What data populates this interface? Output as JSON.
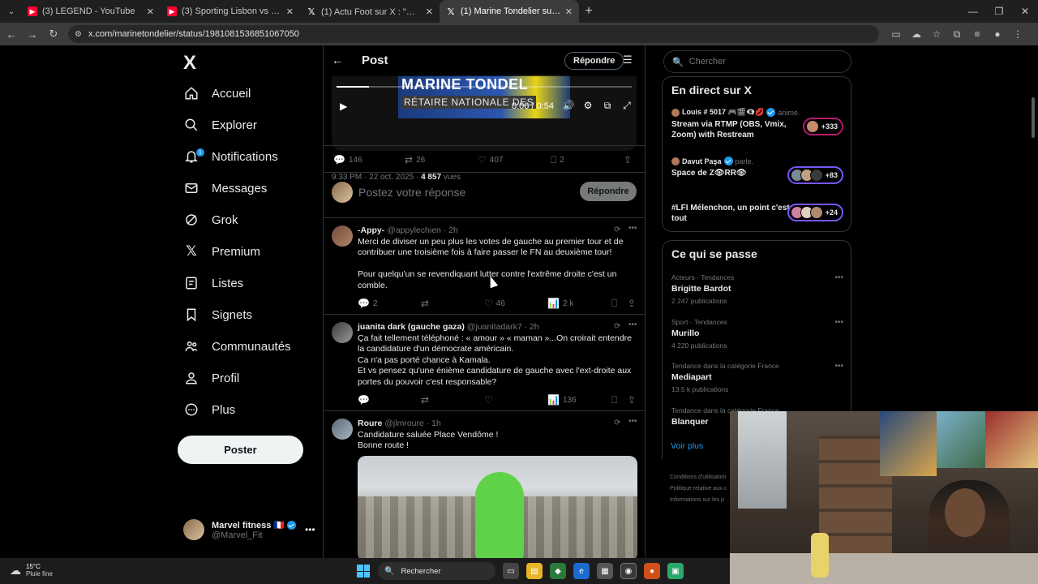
{
  "browser": {
    "tabs": [
      {
        "title": "(3) LEGEND - YouTube",
        "type": "yt",
        "active": false
      },
      {
        "title": "(3) Sporting Lisbon vs Marseille",
        "type": "yt",
        "active": false
      },
      {
        "title": "(1) Actu Foot sur X : \"💄 L'OM",
        "type": "x",
        "active": false
      },
      {
        "title": "(1) Marine Tondelier sur X : \"Ma",
        "type": "x",
        "active": true
      }
    ],
    "url": "x.com/marinetondelier/status/1981081536851067050"
  },
  "sidebar": {
    "logo": "X",
    "items": [
      {
        "label": "Accueil",
        "icon": "home-icon"
      },
      {
        "label": "Explorer",
        "icon": "search-icon"
      },
      {
        "label": "Notifications",
        "icon": "bell-icon",
        "badge": "1"
      },
      {
        "label": "Messages",
        "icon": "mail-icon"
      },
      {
        "label": "Grok",
        "icon": "grok-icon"
      },
      {
        "label": "Premium",
        "icon": "x-premium-icon"
      },
      {
        "label": "Listes",
        "icon": "list-icon"
      },
      {
        "label": "Signets",
        "icon": "bookmark-icon"
      },
      {
        "label": "Communautés",
        "icon": "community-icon"
      },
      {
        "label": "Profil",
        "icon": "person-icon"
      },
      {
        "label": "Plus",
        "icon": "more-circle-icon"
      }
    ],
    "post_button": "Poster",
    "account": {
      "name": "Marvel fitness 🇫🇷",
      "handle": "@Marvel_Fit"
    }
  },
  "main": {
    "header_title": "Post",
    "reply_pill": "Répondre",
    "video": {
      "banner_line1": "MARINE TONDEL",
      "banner_line2": "RÉTAIRE NATIONALE DES",
      "time": "0:06 / 0:54",
      "progress": 0.111
    },
    "post_meta": {
      "datetime": "9:33 PM · 22 oct. 2025 · ",
      "views": "4 857",
      "views_label": " vues"
    },
    "post_stats": {
      "replies": "146",
      "reposts": "26",
      "likes": "407",
      "bookmarks": "2"
    },
    "composer": {
      "placeholder": "Postez votre réponse",
      "button": "Répondre"
    },
    "replies": [
      {
        "name": "-Appy-",
        "handle": "@appylechien · 2h",
        "text": "Merci de diviser un peu plus les votes de gauche au premier tour et de contribuer une troisième fois à faire passer le FN au deuxième tour!\n\nPour quelqu'un se revendiquant lutter contre l'extrême droite c'est un comble.",
        "stats": {
          "replies": "2",
          "reposts": "",
          "likes": "46",
          "views": "2 k"
        }
      },
      {
        "name": "juanita dark (gauche gaza)",
        "handle": "@juanitadark7 · 2h",
        "text": "Ça fait tellement téléphoné : « amour » « maman »...On croirait entendre la candidature d'un démocrate américain.\nCa n'a pas porté chance à Kamala.\nEt vs pensez qu'une énième candidature de gauche avec l'ext-droite aux portes du pouvoir c'est responsable?",
        "stats": {
          "replies": "",
          "reposts": "",
          "likes": "",
          "views": "136"
        }
      },
      {
        "name": "Roure",
        "handle": "@jlmroure · 1h",
        "text": "Candidature saluée Place Vendôme !\nBonne route !"
      }
    ]
  },
  "right": {
    "search_placeholder": "Chercher",
    "live_title": "En direct sur X",
    "live": [
      {
        "host": "Louis # 5017 🎮🎬👁‍🗨💋",
        "action": "anime.",
        "topic": "Stream via RTMP (OBS, Vmix, Zoom) with Restream",
        "count": "+333",
        "ring": "pink"
      },
      {
        "host": "Davut Paşa",
        "action": "parle.",
        "topic": "Space de Z👁RR👁",
        "count": "+83",
        "ring": "purple"
      },
      {
        "host": "",
        "action": "",
        "topic": "#LFI Mélenchon, un point c'est tout",
        "count": "+24",
        "ring": "purple"
      }
    ],
    "trends_title": "Ce qui se passe",
    "trends": [
      {
        "category": "Acteurs · Tendances",
        "name": "Brigitte Bardot",
        "count": "2 247 publications"
      },
      {
        "category": "Sport · Tendances",
        "name": "Murillo",
        "count": "4 220 publications"
      },
      {
        "category": "Tendance dans la catégorie France",
        "name": "Mediapart",
        "count": "13,5 k publications"
      },
      {
        "category": "Tendance dans la catégorie France",
        "name": "Blanquer",
        "count": ""
      }
    ],
    "see_more": "Voir plus",
    "footer": [
      "Conditions d'utilisation",
      "Politique relative aux c",
      "Informations sur les p"
    ]
  },
  "taskbar": {
    "temp": "15°C",
    "weather": "Pluie fine",
    "search": "Rechercher"
  },
  "colors": {
    "accent": "#1d9bf0",
    "bg": "#000000",
    "border": "#2f3336",
    "muted": "#71767b"
  }
}
